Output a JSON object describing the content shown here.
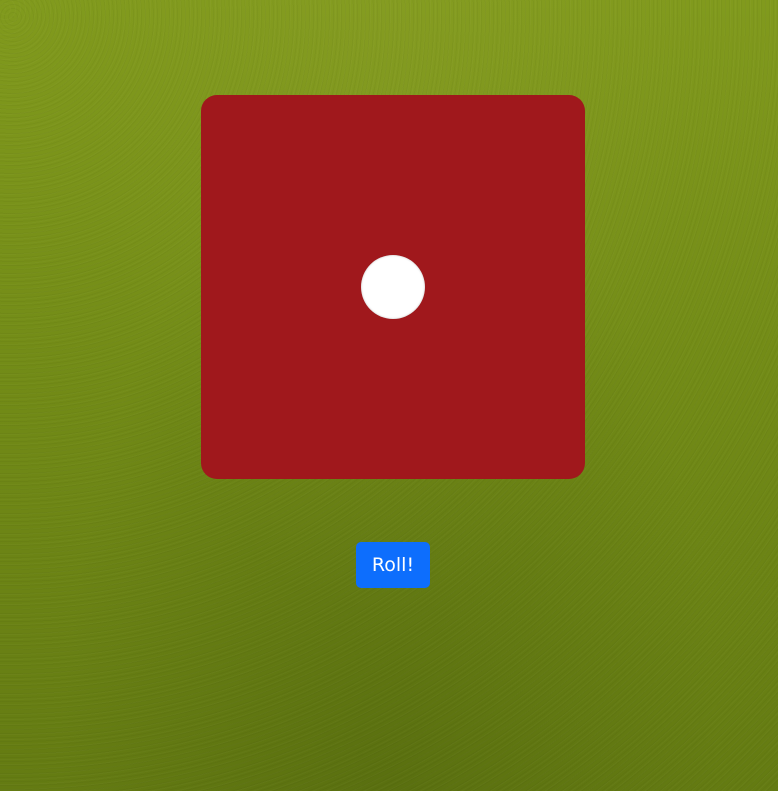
{
  "die": {
    "value": 1,
    "color": "#a0181c",
    "pip_color": "#ffffff"
  },
  "roll_button": {
    "label": "Roll!",
    "color": "#0d6efd"
  },
  "background": {
    "color": "#738c17"
  }
}
